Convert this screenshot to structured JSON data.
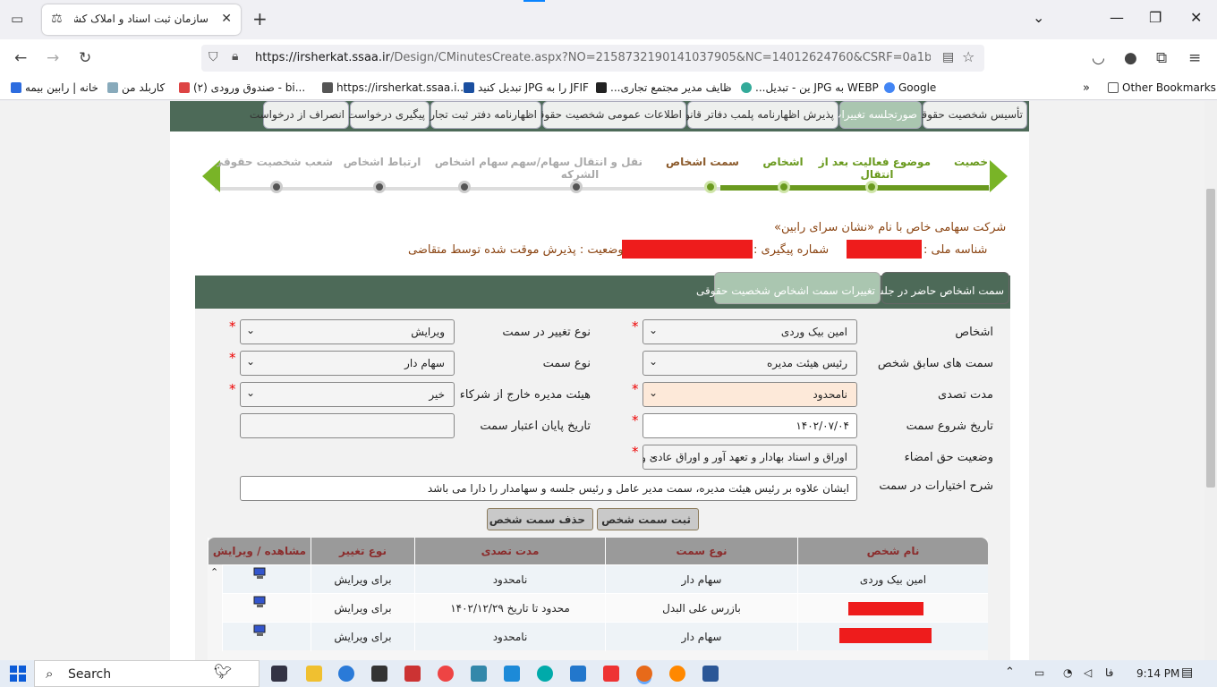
{
  "browser": {
    "tab_title": "سازمان ثبت اسناد و املاک کشور",
    "url_host": "https://irsherkat.ssaa.ir",
    "url_path": "/Design/CMinutesCreate.aspx?NO=2158732190141037905&NC=14012624760&CSRF=0a1bc2f2b",
    "bookmarks": [
      "خانه | رابین بیمه",
      "کاربلد من",
      "(۲) صندوق ورودی - bi...",
      "https://irsherkat.ssaa.i...",
      "تبدیل کنید JPG را به JFIF",
      "...ظایف مدیر مجتمع تجاری",
      "...ین - تبدیل JPG به WEBP",
      "Google"
    ],
    "other_bookmarks": "Other Bookmarks"
  },
  "top_menu": [
    "تأسیس شخصیت حقوقی",
    "صورتجلسه تغییرات",
    "پذیرش اظهارنامه پلمب دفاتر قانونی",
    "اطلاعات عمومی شخصیت حقوقی",
    "اظهارنامه دفتر ثبت تجارتی",
    "پیگیری درخواست",
    "انصراف از درخواست"
  ],
  "wizard": {
    "steps": [
      {
        "label": "خصیت",
        "sub": "",
        "state": "done"
      },
      {
        "label": "موضوع فعالیت بعد از",
        "sub": "انتقال",
        "state": "done"
      },
      {
        "label": "اشخاص",
        "sub": "",
        "state": "done"
      },
      {
        "label": "سمت اشخاص",
        "sub": "",
        "state": "cur"
      },
      {
        "label": "نقل و انتقال سهام/سهم",
        "sub": "الشركه",
        "state": "todo"
      },
      {
        "label": "سهام اشخاص",
        "sub": "",
        "state": "todo"
      },
      {
        "label": "ارتباط اشخاص",
        "sub": "",
        "state": "todo"
      },
      {
        "label": "شعب شخصیت حقوقی و",
        "sub": "",
        "state": "todo"
      }
    ]
  },
  "company": {
    "name_line": "شرکت سهامی خاص با نام «نشان سرای رابین»",
    "national_id_label": "شناسه ملی :",
    "tracking_label": "شماره پیگیری :",
    "status_line": "وضعیت : پذیرش موقت شده توسط متقاضی"
  },
  "tabs": [
    "سمت اشخاص حاضر در جلسه",
    "تغییرات سمت اشخاص شخصیت حقوقی"
  ],
  "form": {
    "person_label": "اشخاص",
    "person_value": "امین بیک وردی",
    "prev_roles_label": "سمت های سابق شخص",
    "prev_roles_value": "رئیس هیئت مدیره",
    "tenure_label": "مدت تصدی",
    "tenure_value": "نامحدود",
    "start_label": "تاریخ شروع سمت",
    "start_value": "۱۴۰۲/۰۷/۰۴",
    "sign_label": "وضعیت حق امضاء",
    "sign_value": "اوراق و اسناد بهادار و تعهد آور و اوراق عادی و ادا",
    "desc_label": "شرح اختیارات در سمت",
    "desc_value": "ایشان علاوه بر رئیس هیئت مدیره، سمت مدیر عامل و رئیس جلسه و سهامدار را دارا می باشد",
    "change_type_label": "نوع تغییر در سمت",
    "change_type_value": "ویرایش",
    "role_type_label": "نوع سمت",
    "role_type_value": "سهام دار",
    "outside_board_label": "هیئت مدیره خارج از شرکاء",
    "outside_board_value": "خیر",
    "end_label": "تاریخ پایان اعتبار سمت",
    "end_value": "",
    "save_button": "ثبت سمت شخص",
    "delete_button": "حذف سمت شخص"
  },
  "grid": {
    "headers": [
      "نام شخص",
      "نوع سمت",
      "مدت تصدی",
      "نوع تغییر",
      "مشاهده / ویرایش"
    ],
    "rows": [
      {
        "name": "امین بیک وردی",
        "role": "سهام دار",
        "tenure": "نامحدود",
        "change": "برای ویرایش"
      },
      {
        "name": "",
        "role": "بازرس علی البدل",
        "tenure": "محدود تا تاریخ ۱۴۰۲/۱۲/۲۹",
        "change": "برای ویرایش"
      },
      {
        "name": "",
        "role": "سهام دار",
        "tenure": "نامحدود",
        "change": "برای ویرایش"
      }
    ]
  },
  "taskbar": {
    "search": "Search",
    "time": "9:14 PM",
    "lang": "فا"
  }
}
